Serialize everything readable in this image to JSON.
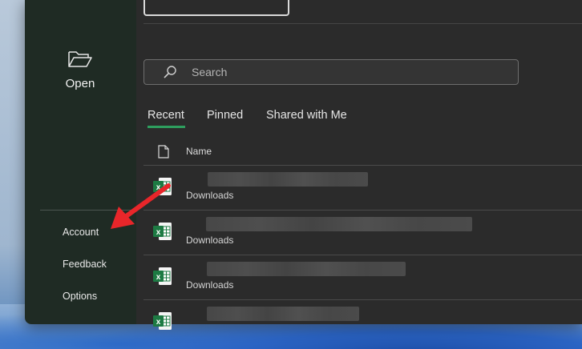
{
  "sidebar": {
    "open_label": "Open",
    "items": [
      {
        "label": "Account"
      },
      {
        "label": "Feedback"
      },
      {
        "label": "Options"
      }
    ]
  },
  "search": {
    "placeholder": "Search"
  },
  "tabs": [
    {
      "label": "Recent",
      "active": true
    },
    {
      "label": "Pinned"
    },
    {
      "label": "Shared with Me"
    }
  ],
  "list": {
    "header_name": "Name",
    "files": [
      {
        "location": "Downloads",
        "icon": "excel-file-icon"
      },
      {
        "location": "Downloads",
        "icon": "excel-file-icon"
      },
      {
        "location": "Downloads",
        "icon": "excel-file-icon"
      },
      {
        "location": "",
        "icon": "excel-file-icon"
      }
    ]
  },
  "colors": {
    "accent": "#2e9e5e",
    "annotation_arrow": "#e8262a",
    "excel_green": "#1d7a43"
  }
}
